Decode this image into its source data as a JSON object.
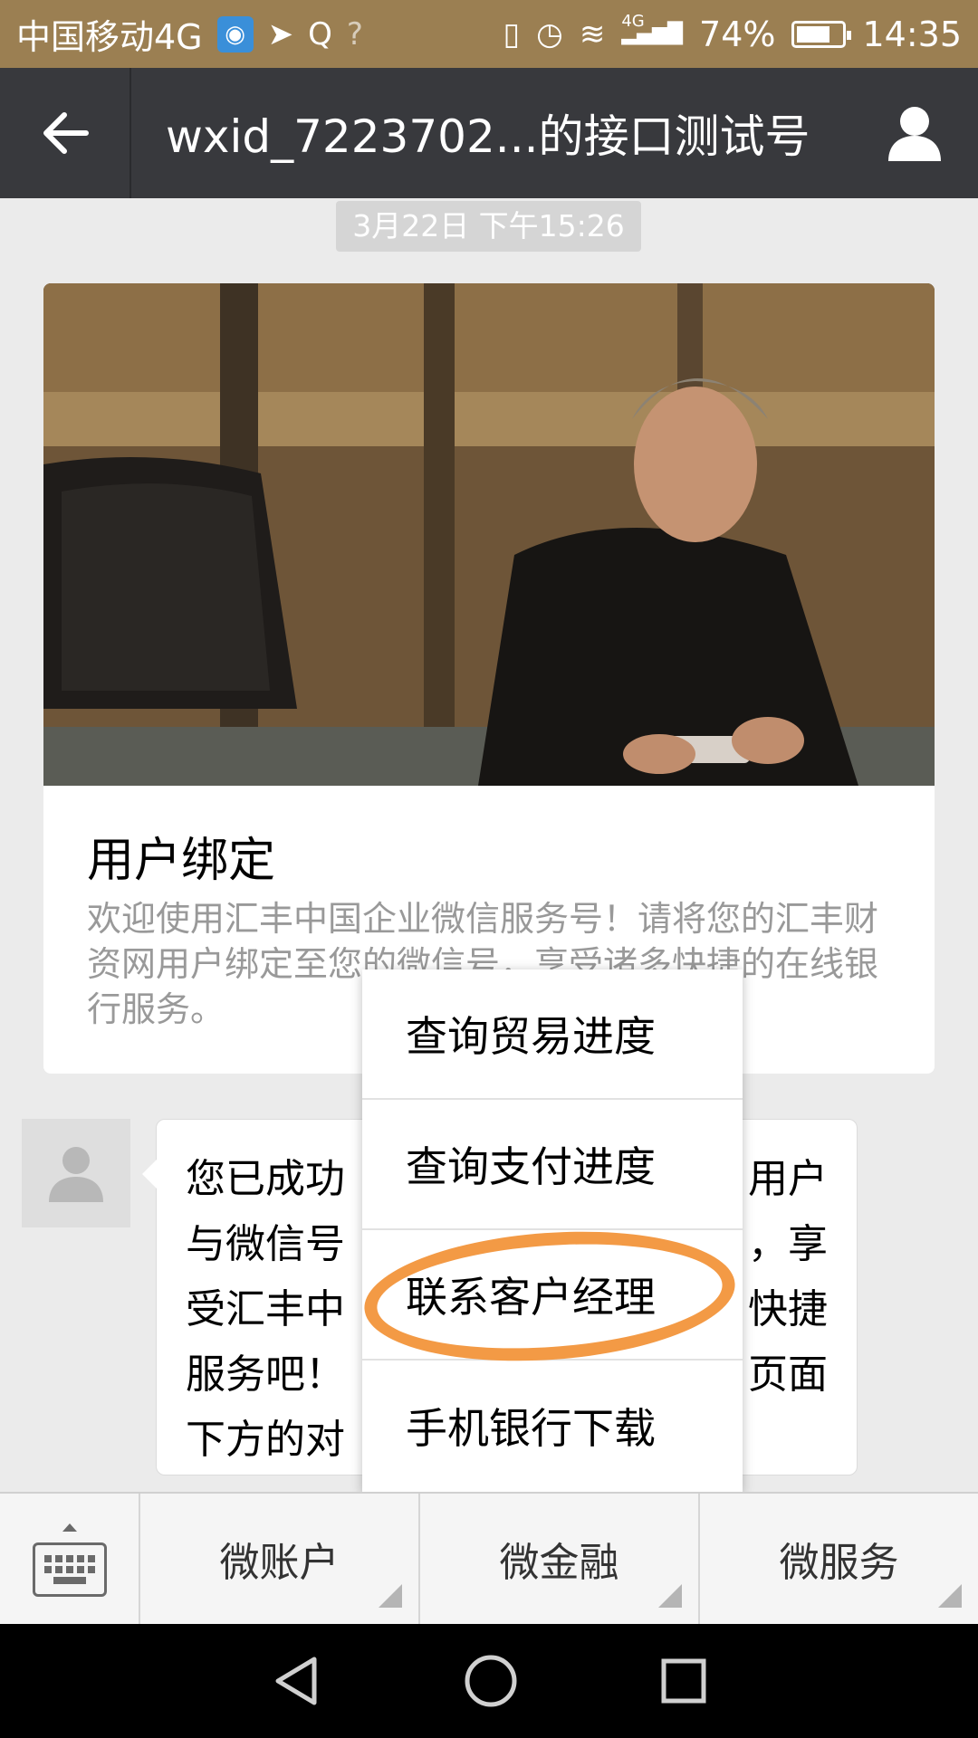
{
  "status_bar": {
    "carrier": "中国移动4G",
    "network_badge": "4G",
    "battery": "74%",
    "battery_level": 0.74,
    "time": "14:35"
  },
  "header": {
    "title": "wxid_7223702...的接口测试号"
  },
  "chat": {
    "timestamp": "3月22日 下午15:26",
    "article": {
      "title": "用户绑定",
      "description": "欢迎使用汇丰中国企业微信服务号！请将您的汇丰财资网用户绑定至您的微信号，享受诸多快捷的在线银行服务。"
    },
    "message_lines": [
      "您已成功",
      "与微信号",
      "受汇丰中",
      "服务吧！",
      "下方的对"
    ],
    "message_lines_right": [
      "用户",
      "，享",
      "快捷",
      "页面",
      ""
    ]
  },
  "popup_menu": {
    "items": [
      "查询贸易进度",
      "查询支付进度",
      "联系客户经理",
      "手机银行下载"
    ],
    "highlight_color": "#f39a45"
  },
  "bottom_menu": {
    "tabs": [
      "微账户",
      "微金融",
      "微服务"
    ]
  },
  "icons": {
    "back": "arrow-left-icon",
    "profile": "person-icon",
    "keyboard": "keyboard-icon"
  }
}
